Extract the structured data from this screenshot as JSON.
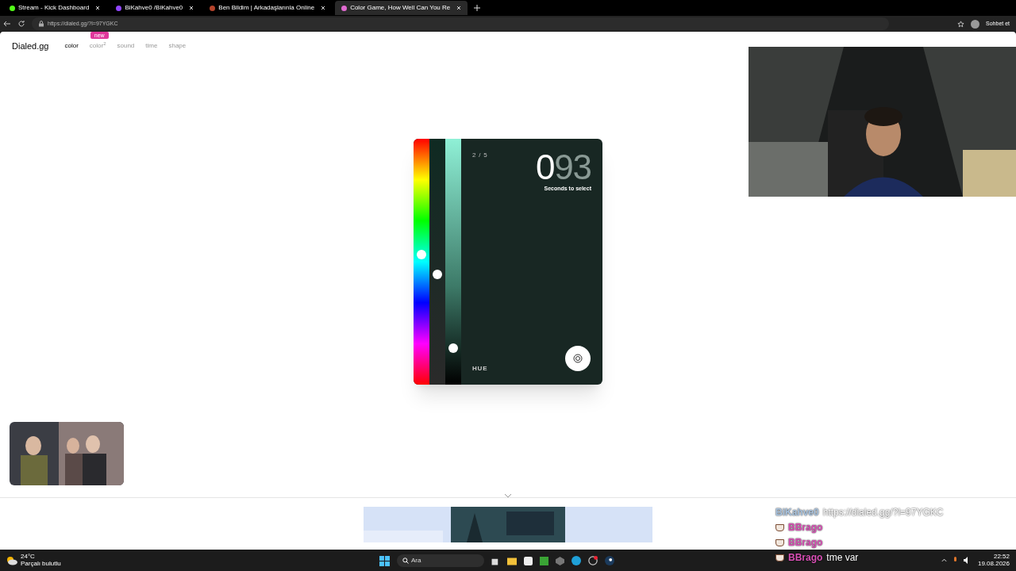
{
  "browser": {
    "tabs": [
      {
        "title": "Stream - Kick Dashboard",
        "selected": false,
        "kind": "kick"
      },
      {
        "title": "BiKahve0 /BiKahve0",
        "selected": false,
        "kind": "twitch"
      },
      {
        "title": "Ben Bildim | Arkadaşlarınla Online",
        "selected": false,
        "kind": "quiz"
      },
      {
        "title": "Color Game, How Well Can You Re",
        "selected": true,
        "kind": "color"
      }
    ],
    "address": "https://dialed.gg/?l=97YGKC",
    "assistant_label": "Sohbet et"
  },
  "site": {
    "logo": "Dialed.gg",
    "nav": [
      {
        "label": "color",
        "selected": true
      },
      {
        "label": "color$^{2}$",
        "selected": false,
        "badge": "new"
      },
      {
        "label": "sound",
        "selected": false
      },
      {
        "label": "time",
        "selected": false
      },
      {
        "label": "shape",
        "selected": false
      }
    ]
  },
  "game": {
    "round": "2 / 5",
    "timer_lead": "0",
    "timer_rest": "93",
    "timer_caption": "Seconds to select",
    "slider_label": "HUE",
    "sliders": [
      {
        "kind": "hue",
        "level": 0.53
      },
      {
        "kind": "saturation",
        "level": 0.45
      },
      {
        "kind": "lightness",
        "level": 0.15
      }
    ]
  },
  "chat": [
    {
      "user": "BiKahve0",
      "text": "https://dialed.gg/?l=97YGKC",
      "color": "#a9c4e0",
      "badge": false
    },
    {
      "user": "BBrago",
      "color": "#d94fb5",
      "badge": true
    },
    {
      "user": "BBrago",
      "color": "#d94fb5",
      "badge": true
    },
    {
      "user": "BBrago",
      "text": "tme var",
      "color": "#d94fb5",
      "badge": true
    }
  ],
  "taskbar": {
    "temperature": "24°C",
    "weather": "Parçalı bulutlu",
    "search_placeholder": "Ara",
    "time": "22:52",
    "date": "19.08.2026"
  }
}
